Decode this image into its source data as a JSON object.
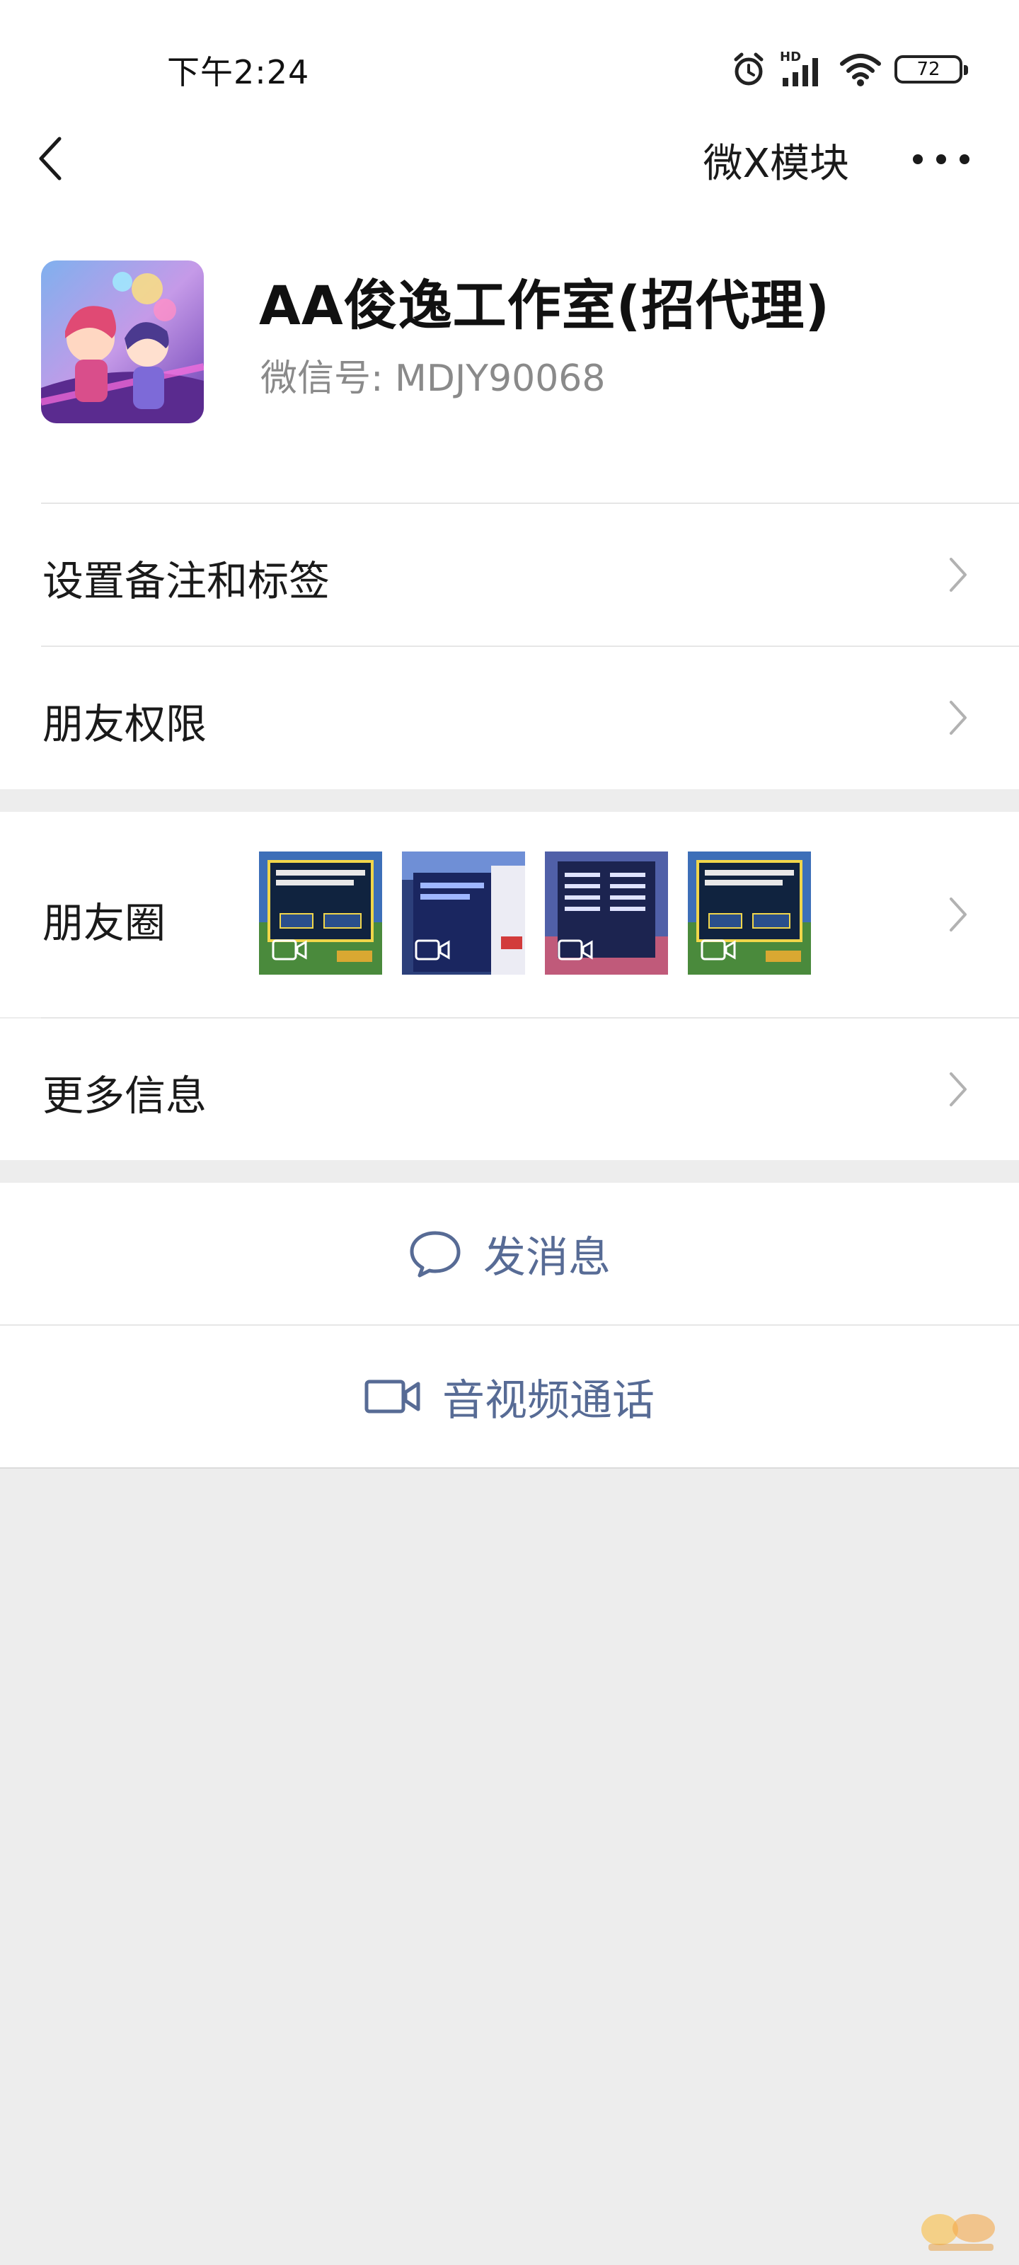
{
  "status_bar": {
    "time": "下午2:24",
    "network_label": "HD",
    "battery": "72"
  },
  "nav": {
    "title": "微X模块"
  },
  "profile": {
    "name": "AA俊逸工作室(招代理)",
    "wechat_id": "微信号: MDJY90068"
  },
  "menu": {
    "remark_tags": "设置备注和标签",
    "friend_permissions": "朋友权限",
    "moments": "朋友圈",
    "more_info": "更多信息"
  },
  "actions": {
    "send_message": "发消息",
    "video_call": "音视频通话"
  },
  "colors": {
    "link_blue": "#576b95",
    "background": "#ededed",
    "divider": "#e6e6e6"
  }
}
